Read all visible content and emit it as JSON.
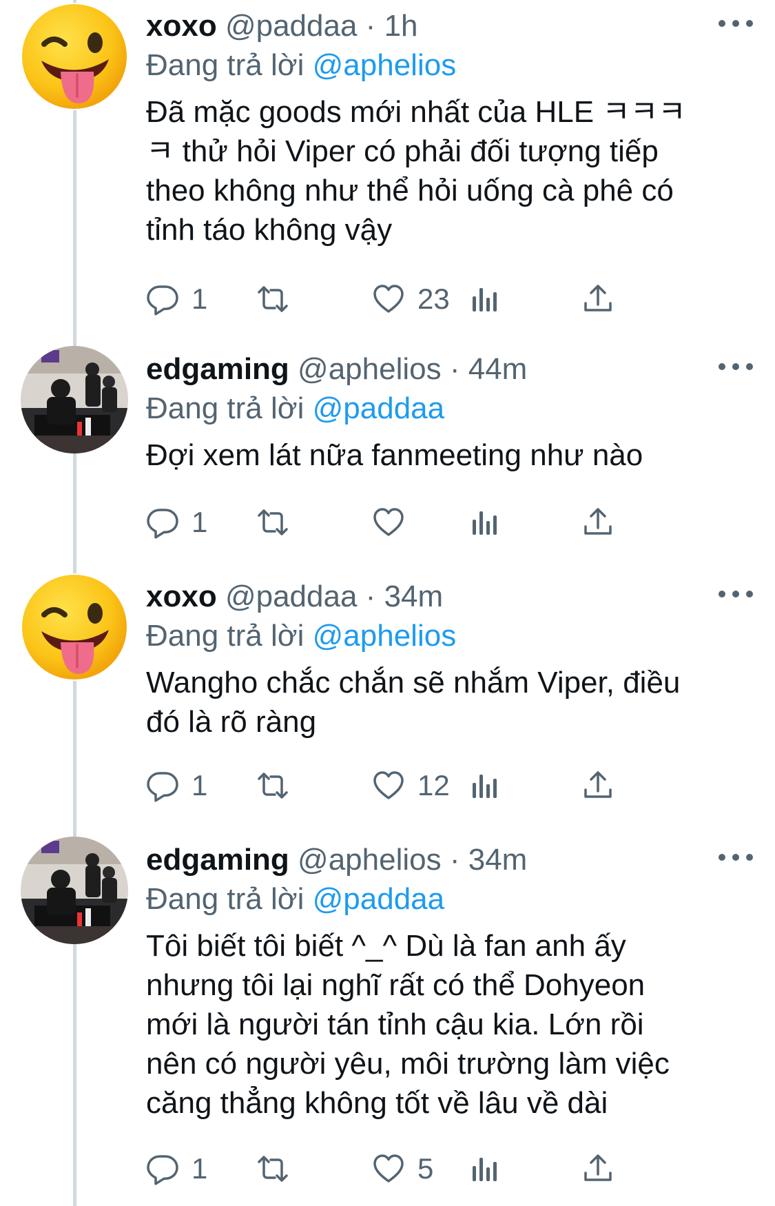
{
  "replying_prefix": "Đang trả lời",
  "tweets": [
    {
      "name": "xoxo",
      "handle": "@paddaa",
      "separator": "·",
      "time": "1h",
      "reply_to": "@aphelios",
      "avatar": "winking-tongue-emoji",
      "text": "Đã mặc goods mới nhất của HLE ㅋㅋㅋ\nㅋ thử hỏi Viper có phải đối tượng tiếp\ntheo không như thể hỏi uống cà phê có\ntỉnh táo không vậy",
      "replies": "1",
      "retweets": "",
      "likes": "23"
    },
    {
      "name": "edgaming",
      "handle": "@aphelios",
      "separator": "·",
      "time": "44m",
      "reply_to": "@paddaa",
      "avatar": "fan-meeting-photo",
      "text": "Đợi xem lát nữa fanmeeting như nào",
      "replies": "1",
      "retweets": "",
      "likes": ""
    },
    {
      "name": "xoxo",
      "handle": "@paddaa",
      "separator": "·",
      "time": "34m",
      "reply_to": "@aphelios",
      "avatar": "winking-tongue-emoji",
      "text": "Wangho chắc chắn sẽ nhắm Viper, điều\nđó là rõ ràng",
      "replies": "1",
      "retweets": "",
      "likes": "12"
    },
    {
      "name": "edgaming",
      "handle": "@aphelios",
      "separator": "·",
      "time": "34m",
      "reply_to": "@paddaa",
      "avatar": "fan-meeting-photo",
      "text": "Tôi biết tôi biết ^_^ Dù là fan anh ấy\nnhưng tôi lại nghĩ rất có thể Dohyeon\nmới là người tán tỉnh cậu kia. Lớn rồi\nnên có người yêu, môi trường làm việc\ncăng thẳng không tốt về lâu về dài",
      "replies": "1",
      "retweets": "",
      "likes": "5"
    }
  ],
  "colors": {
    "text": "#0f1419",
    "secondary": "#536471",
    "link": "#1d9bf0",
    "thread_line": "#cfd9de"
  }
}
